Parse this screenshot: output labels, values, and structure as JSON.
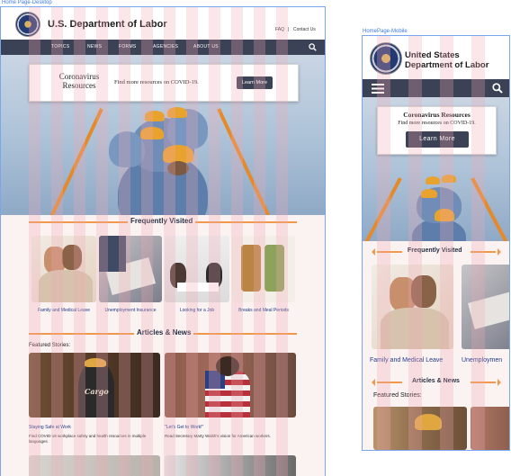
{
  "frames": {
    "desktop_label": "Home Page-Desktop",
    "mobile_label": "HomePage-Mobile"
  },
  "header": {
    "title": "U.S. Department of Labor",
    "mobile_title_line1": "United States",
    "mobile_title_line2": "Department of Labor",
    "faq": "FAQ",
    "separator": "|",
    "contact": "Contact Us"
  },
  "nav": {
    "items": [
      "TOPICS",
      "NEWS",
      "FORMS",
      "AGENCIES",
      "ABOUT US"
    ]
  },
  "covid": {
    "title_line1": "Coronavirus",
    "title_line2": "Resources",
    "title_mobile": "Coronavirus Resources",
    "text": "Find more resources on COVID-19.",
    "button": "Learn More"
  },
  "frequently_visited": {
    "title": "Frequently Visited",
    "cards": [
      "Family and Medical Leave",
      "Unemployment Insurance",
      "Looking for a Job",
      "Breaks and Meal Periods"
    ],
    "mobile_second_card_partial": "Unemploymen"
  },
  "articles": {
    "title": "Articles & News",
    "featured_label": "Featured Stories:",
    "stories": [
      {
        "title": "Staying Safe at Work",
        "text": "Find COVID-19 workplace safety and health resources in multiple languages",
        "image_text": "Cargo"
      },
      {
        "title": "\"Let's Get to Work!\"",
        "text": "Read Secretary Marty Walsh's vision for American workers."
      }
    ]
  },
  "colors": {
    "nav": "#3c4256",
    "accent": "#f0994c",
    "link": "#1f3a8a",
    "frame_outline": "#7aa6ee"
  },
  "icons": [
    "seal-logo",
    "search-icon",
    "hamburger-icon",
    "arrow-left-icon",
    "arrow-right-icon"
  ]
}
